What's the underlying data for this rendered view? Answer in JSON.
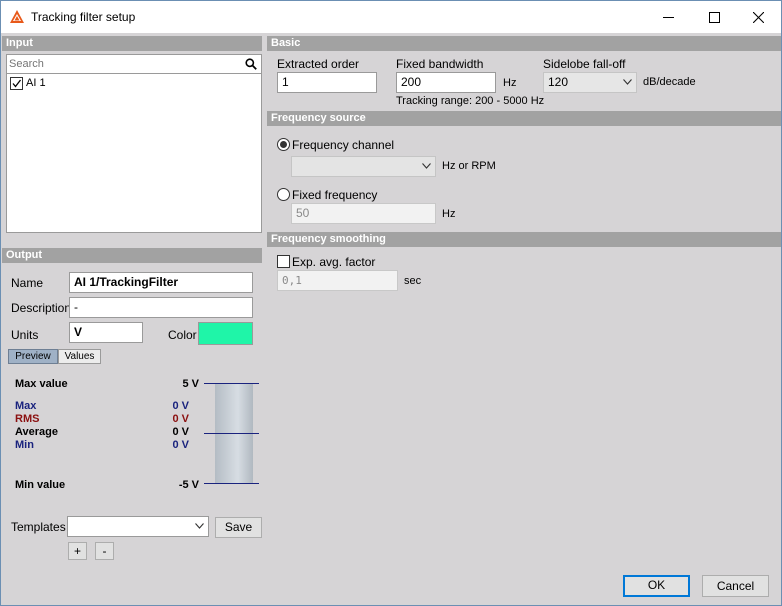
{
  "window": {
    "title": "Tracking filter setup"
  },
  "colors": {
    "output_color": "#1ff5a8",
    "max_blue": "#1a237e",
    "rms_red": "#8b1010",
    "section_header": "#a2a2a2"
  },
  "input": {
    "header": "Input",
    "search_placeholder": "Search",
    "channels": [
      {
        "label": "AI 1",
        "checked": true
      }
    ]
  },
  "output": {
    "header": "Output",
    "name_label": "Name",
    "name_value": "AI 1/TrackingFilter",
    "description_label": "Description",
    "description_value": "-",
    "units_label": "Units",
    "units_value": "V",
    "color_label": "Color",
    "tabs": [
      "Preview",
      "Values"
    ],
    "preview": {
      "max_value_label": "Max value",
      "max_value": "5 V",
      "max_label": "Max",
      "max": "0 V",
      "rms_label": "RMS",
      "rms": "0 V",
      "average_label": "Average",
      "average": "0 V",
      "min_label": "Min",
      "min": "0 V",
      "min_value_label": "Min value",
      "min_value": "-5 V"
    },
    "templates_label": "Templates",
    "templates_value": "",
    "save_label": "Save",
    "add_label": "+",
    "remove_label": "-"
  },
  "basic": {
    "header": "Basic",
    "extracted_order_label": "Extracted order",
    "extracted_order_value": "1",
    "fixed_bandwidth_label": "Fixed bandwidth",
    "fixed_bandwidth_value": "200",
    "fixed_bandwidth_unit": "Hz",
    "tracking_range": "Tracking range: 200 - 5000 Hz",
    "sidelobe_label": "Sidelobe fall-off",
    "sidelobe_value": "120",
    "sidelobe_unit": "dB/decade"
  },
  "frequency_source": {
    "header": "Frequency source",
    "channel_label": "Frequency channel",
    "channel_selected": true,
    "channel_value": "",
    "channel_unit": "Hz or RPM",
    "fixed_label": "Fixed frequency",
    "fixed_value": "50",
    "fixed_unit": "Hz"
  },
  "frequency_smoothing": {
    "header": "Frequency smoothing",
    "exp_label": "Exp. avg. factor",
    "exp_checked": false,
    "exp_value": "0,1",
    "exp_unit": "sec"
  },
  "footer": {
    "ok_label": "OK",
    "cancel_label": "Cancel"
  }
}
